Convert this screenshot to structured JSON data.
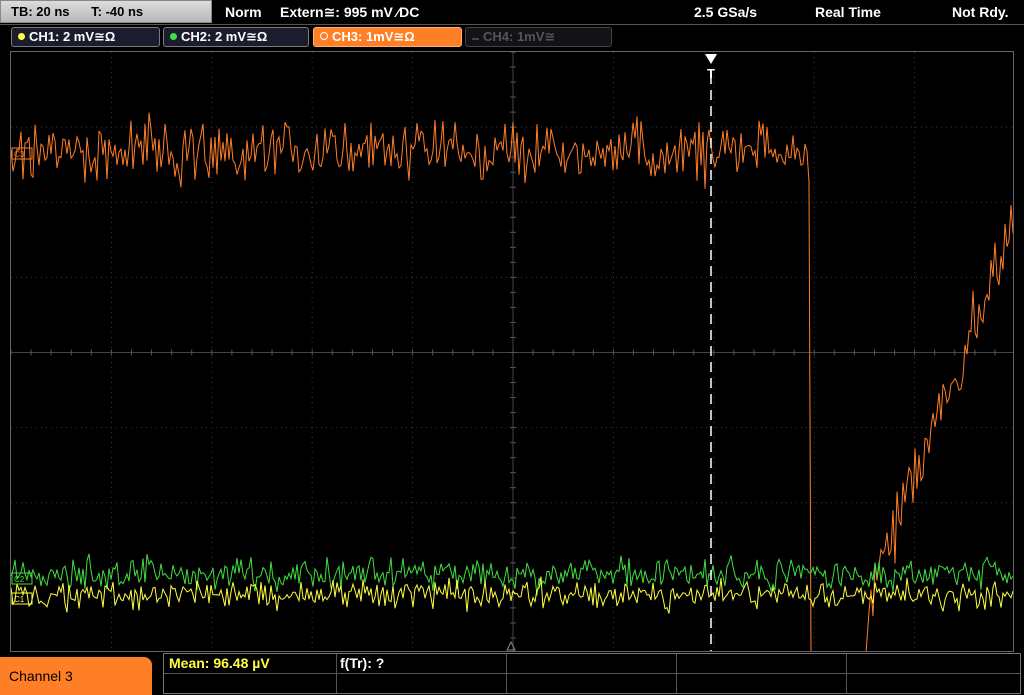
{
  "header": {
    "timebase": "TB: 20 ns",
    "trigger_time": "T: -40 ns",
    "trigger_mode": "Norm",
    "trigger_source": "Extern≅: 995 mV ⁄DC",
    "sample_rate": "2.5 GSa/s",
    "acquire_mode": "Real Time",
    "status": "Not Rdy."
  },
  "channels": [
    {
      "label": "CH1: 2 mV≅Ω",
      "color": "#ffff40",
      "state": "on"
    },
    {
      "label": "CH2: 2 mV≅Ω",
      "color": "#40e040",
      "state": "on"
    },
    {
      "label": "CH3: 1mV≅Ω",
      "color": "#ff7f27",
      "state": "active"
    },
    {
      "label": "CH4: 1mV≅",
      "color": "#555555",
      "state": "off"
    }
  ],
  "markers": {
    "trigger": "T",
    "ch1": "C1",
    "ch2": "C2",
    "ch3": "C3"
  },
  "footer": {
    "selected_channel": "Channel 3",
    "mean": "Mean: 96.48 µV",
    "frequency": "f(Tr): ?"
  },
  "colors": {
    "ch1": "#ffff40",
    "ch2": "#40e040",
    "ch3": "#ff7f27",
    "grid": "#3a3a3a",
    "background": "#000000"
  }
}
